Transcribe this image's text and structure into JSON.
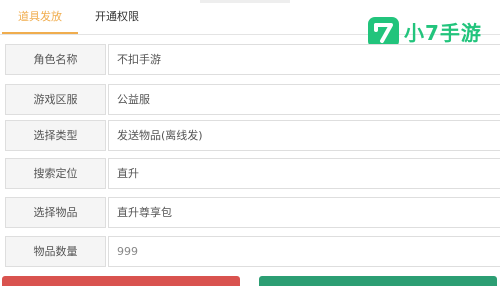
{
  "tabs": [
    {
      "label": "道具发放",
      "active": true
    },
    {
      "label": "开通权限",
      "active": false
    }
  ],
  "form": {
    "rows": [
      {
        "label": "角色名称",
        "value": "不扣手游"
      },
      {
        "label": "游戏区服",
        "value": "公益服"
      },
      {
        "label": "选择类型",
        "value": "发送物品(离线发)"
      },
      {
        "label": "搜索定位",
        "value": "直升"
      },
      {
        "label": "选择物品",
        "value": "直升尊享包"
      },
      {
        "label": "物品数量",
        "value": "999"
      }
    ]
  },
  "logo": {
    "mark_text": "7",
    "text": "小7手游"
  },
  "colors": {
    "tab_active": "#f0ad4e",
    "logo_green": "#22c47c",
    "button_red": "#d9534f",
    "button_green": "#2c9e73"
  }
}
